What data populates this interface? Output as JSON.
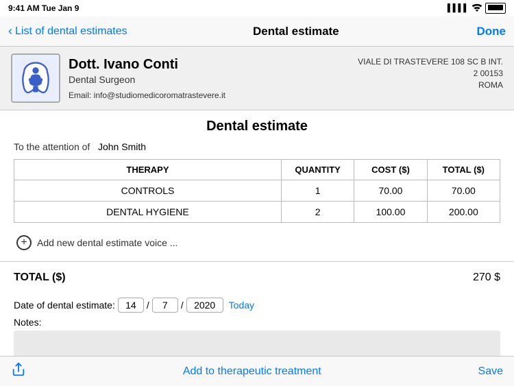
{
  "statusBar": {
    "time": "9:41 AM",
    "date": "Tue Jan 9",
    "signal": "●●●●",
    "wifi": "WiFi",
    "battery": "Battery"
  },
  "navBar": {
    "backLabel": "List of dental estimates",
    "title": "Dental estimate",
    "doneLabel": "Done"
  },
  "doctorCard": {
    "name": "Dott. Ivano Conti",
    "title": "Dental Surgeon",
    "email": "Email: info@studiomedicoromatrastevere.it",
    "address": "VIALE DI TRASTEVERE 108 SC B INT. 2 00153\nROMA"
  },
  "estimate": {
    "title": "Dental estimate",
    "attentionLabel": "To the attention of",
    "patientName": "John Smith",
    "table": {
      "headers": [
        "THERAPY",
        "QUANTITY",
        "COST ($)",
        "TOTAL ($)"
      ],
      "rows": [
        {
          "therapy": "CONTROLS",
          "quantity": "1",
          "cost": "70.00",
          "total": "70.00"
        },
        {
          "therapy": "DENTAL HYGIENE",
          "quantity": "2",
          "cost": "100.00",
          "total": "200.00"
        }
      ]
    },
    "addLabel": "Add new dental estimate voice ...",
    "totalLabel": "TOTAL ($)",
    "totalValue": "270 $",
    "dateLabel": "Date of dental estimate:",
    "dateDay": "14",
    "dateMonth": "7",
    "dateYear": "2020",
    "todayLabel": "Today",
    "notesLabel": "Notes:"
  },
  "bottomBar": {
    "centerLabel": "Add to therapeutic treatment",
    "saveLabel": "Save"
  }
}
